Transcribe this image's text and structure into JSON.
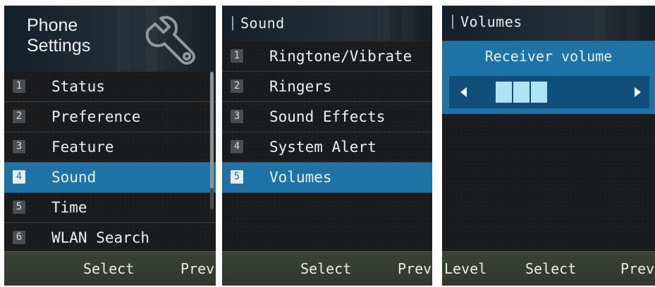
{
  "screens": [
    {
      "header_title": [
        "Phone",
        "Settings"
      ],
      "header_icon": "wrench-settings-icon",
      "items": [
        {
          "num": "1",
          "label": "Status"
        },
        {
          "num": "2",
          "label": "Preference"
        },
        {
          "num": "3",
          "label": "Feature"
        },
        {
          "num": "4",
          "label": "Sound",
          "selected": true
        },
        {
          "num": "5",
          "label": "Time"
        },
        {
          "num": "6",
          "label": "WLAN Search"
        }
      ],
      "softkeys": {
        "center": "Select",
        "right": "Prev"
      }
    },
    {
      "header_title": "Sound",
      "items": [
        {
          "num": "1",
          "label": "Ringtone/Vibrate"
        },
        {
          "num": "2",
          "label": "Ringers"
        },
        {
          "num": "3",
          "label": "Sound Effects"
        },
        {
          "num": "4",
          "label": "System Alert"
        },
        {
          "num": "5",
          "label": "Volumes",
          "selected": true
        }
      ],
      "softkeys": {
        "center": "Select",
        "right": "Prev"
      }
    },
    {
      "header_title": "Volumes",
      "volume": {
        "label": "Receiver volume",
        "level": 3,
        "max_segments": 8
      },
      "softkeys": {
        "left": "Level",
        "center": "Select",
        "right": "Prev"
      }
    }
  ],
  "colors": {
    "selection": "#1e73a6",
    "volume_fill": "#aee3f4",
    "softkey_bar": "#343c34",
    "background": "#1a1b1c"
  }
}
